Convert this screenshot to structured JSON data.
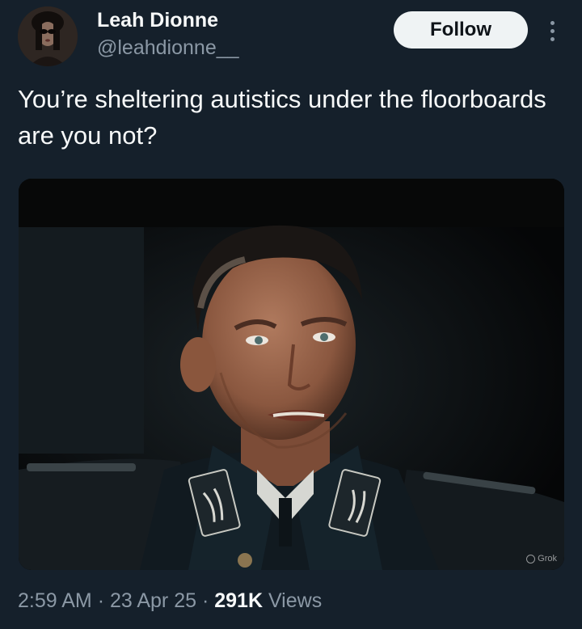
{
  "author": {
    "display_name": "Leah Dionne",
    "handle": "@leahdionne__"
  },
  "actions": {
    "follow_label": "Follow",
    "more_icon": "more-vertical-icon"
  },
  "tweet": {
    "text": "You’re sheltering autistics under the floorboards are you not?"
  },
  "media": {
    "watermark": "Grok"
  },
  "meta": {
    "time": "2:59 AM",
    "separator": "·",
    "date": "23 Apr 25",
    "views_count": "291K",
    "views_label": "Views"
  },
  "colors": {
    "background": "#15202b",
    "primary_text": "#f7f9f9",
    "secondary_text": "#8b98a5",
    "follow_button_bg": "#eff3f4"
  }
}
